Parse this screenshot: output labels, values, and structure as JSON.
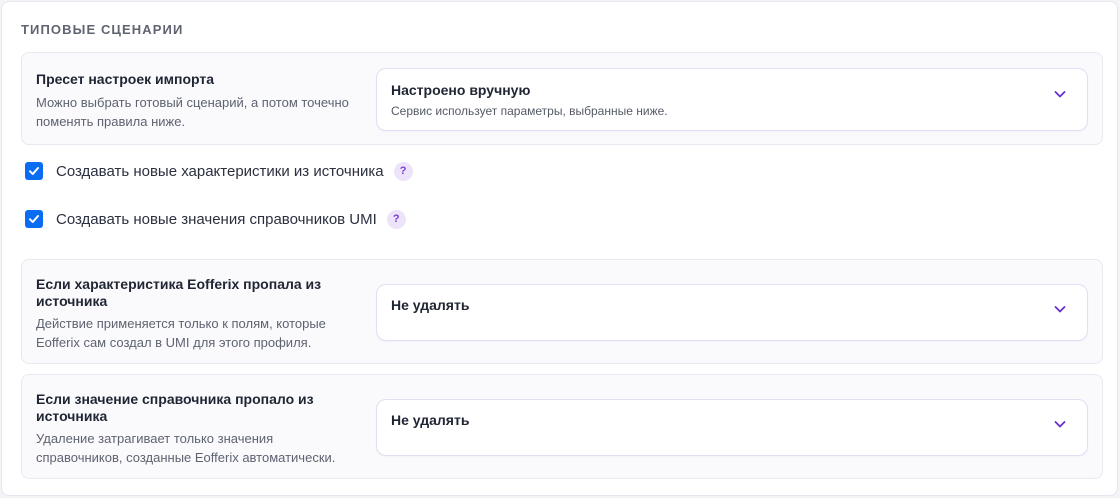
{
  "section": {
    "title": "ТИПОВЫЕ СЦЕНАРИИ"
  },
  "preset": {
    "label": "Пресет настроек импорта",
    "help": "Можно выбрать готовый сценарий, а потом точечно поменять правила ниже.",
    "select": {
      "value": "Настроено вручную",
      "description": "Сервис использует параметры, выбранные ниже."
    }
  },
  "checkboxes": [
    {
      "label": "Создавать новые характеристики из источника",
      "checked": true,
      "help_icon": "?"
    },
    {
      "label": "Создавать новые значения справочников UMI",
      "checked": true,
      "help_icon": "?"
    }
  ],
  "missing_characteristic": {
    "label": "Если характеристика Eofferix пропала из источника",
    "help": "Действие применяется только к полям, которые Eofferix сам создал в UMI для этого профиля.",
    "select": {
      "value": "Не удалять"
    }
  },
  "missing_reference": {
    "label": "Если значение справочника пропало из источника",
    "help": "Удаление затрагивает только значения справочников, созданные Eofferix автоматически.",
    "select": {
      "value": "Не удалять"
    }
  },
  "colors": {
    "accent_purple": "#6a2fd1",
    "checkbox_blue": "#0a6cf2",
    "badge_bg": "#ede3fb"
  }
}
